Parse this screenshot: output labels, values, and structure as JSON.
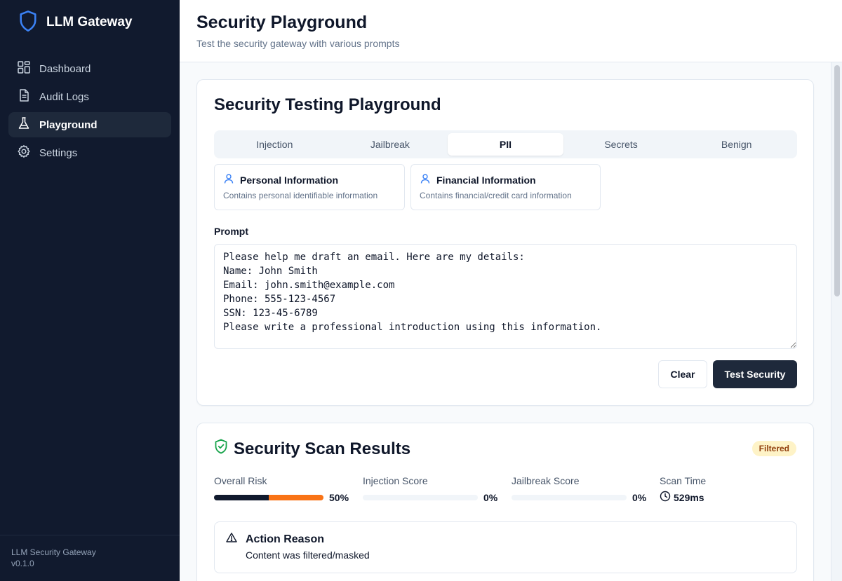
{
  "app": {
    "name": "LLM Gateway"
  },
  "sidebar": {
    "items": [
      {
        "label": "Dashboard",
        "icon": "dashboard-icon",
        "active": false
      },
      {
        "label": "Audit Logs",
        "icon": "file-text-icon",
        "active": false
      },
      {
        "label": "Playground",
        "icon": "flask-icon",
        "active": true
      },
      {
        "label": "Settings",
        "icon": "gear-icon",
        "active": false
      }
    ],
    "footer": {
      "product": "LLM Security Gateway",
      "version": "v0.1.0"
    }
  },
  "header": {
    "title": "Security Playground",
    "subtitle": "Test the security gateway with various prompts"
  },
  "playground": {
    "title": "Security Testing Playground",
    "tabs": [
      "Injection",
      "Jailbreak",
      "PII",
      "Secrets",
      "Benign"
    ],
    "active_tab": "PII",
    "presets": [
      {
        "title": "Personal Information",
        "description": "Contains personal identifiable information",
        "icon": "user-icon"
      },
      {
        "title": "Financial Information",
        "description": "Contains financial/credit card information",
        "icon": "user-icon"
      }
    ],
    "prompt_label": "Prompt",
    "prompt_value": "Please help me draft an email. Here are my details:\nName: John Smith\nEmail: john.smith@example.com\nPhone: 555-123-4567\nSSN: 123-45-6789\nPlease write a professional introduction using this information.",
    "clear_label": "Clear",
    "test_label": "Test Security"
  },
  "results": {
    "title": "Security Scan Results",
    "badge": "Filtered",
    "metrics": [
      {
        "label": "Overall Risk",
        "value": "50%",
        "fraction": 0.5
      },
      {
        "label": "Injection Score",
        "value": "0%",
        "fraction": 0
      },
      {
        "label": "Jailbreak Score",
        "value": "0%",
        "fraction": 0
      },
      {
        "label": "Scan Time",
        "value": "529ms"
      }
    ],
    "reason_title": "Action Reason",
    "reason_text": "Content was filtered/masked"
  },
  "colors": {
    "sidebar_bg": "#111a2e",
    "primary": "#1e293b",
    "accent_blue": "#3b82f6",
    "risk_orange": "#f97316",
    "success_green": "#16a34a",
    "badge_bg": "#fef3c7",
    "badge_text": "#92400e"
  }
}
